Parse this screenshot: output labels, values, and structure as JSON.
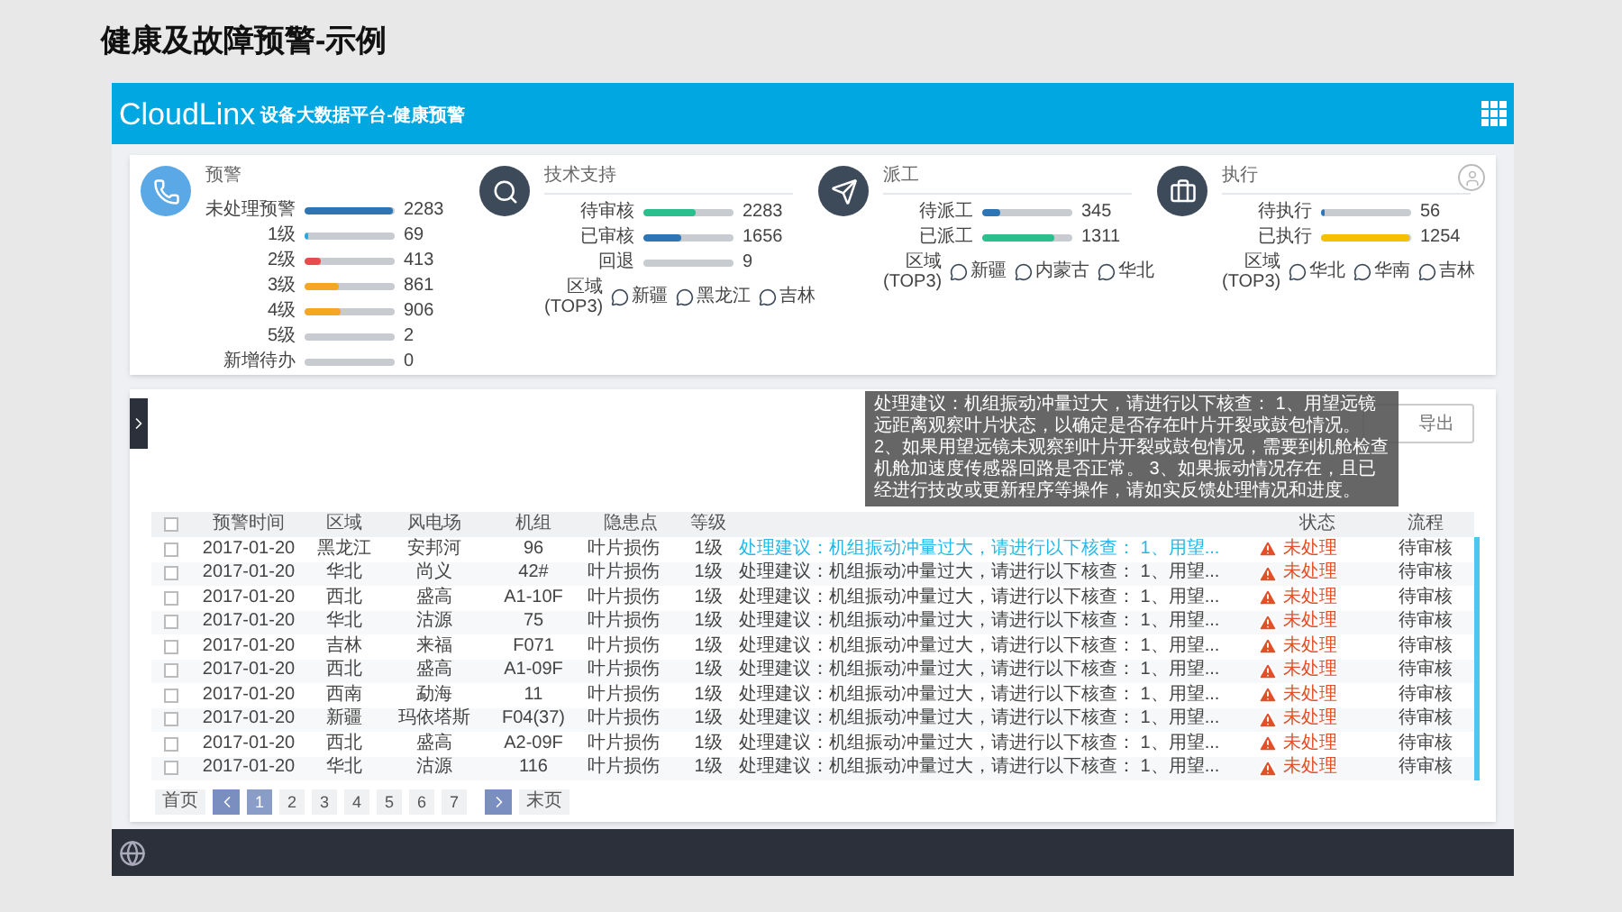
{
  "slide_title": "健康及故障预警-示例",
  "app": {
    "logo": "CloudLinx",
    "title": "设备大数据平台-健康预警"
  },
  "panels": [
    {
      "title": "预警",
      "metrics": [
        {
          "label": "未处理预警",
          "value": "2283",
          "level": 0.97,
          "color": "#2e75b6"
        },
        {
          "label": "1级",
          "value": "69",
          "level": 0.03,
          "color": "#29a8e0"
        },
        {
          "label": "2级",
          "value": "413",
          "level": 0.18,
          "color": "#e84c4c"
        },
        {
          "label": "3级",
          "value": "861",
          "level": 0.38,
          "color": "#f5a623"
        },
        {
          "label": "4级",
          "value": "906",
          "level": 0.4,
          "color": "#f5a623"
        },
        {
          "label": "5级",
          "value": "2"
        },
        {
          "label": "新增待办",
          "value": "0"
        }
      ]
    },
    {
      "title": "技术支持",
      "metrics": [
        {
          "label": "待审核",
          "value": "2283",
          "level": 0.58,
          "color": "#2bbf8e"
        },
        {
          "label": "已审核",
          "value": "1656",
          "level": 0.42,
          "color": "#2e75b6"
        },
        {
          "label": "回退",
          "value": "9"
        }
      ],
      "regions_label": [
        "区域",
        "(TOP3)"
      ],
      "regions": [
        "新疆",
        "黑龙江",
        "吉林"
      ]
    },
    {
      "title": "派工",
      "metrics": [
        {
          "label": "待派工",
          "value": "345",
          "level": 0.2,
          "color": "#2e75b6"
        },
        {
          "label": "已派工",
          "value": "1311",
          "level": 0.8,
          "color": "#2bbf8e"
        }
      ],
      "regions_label": [
        "区域",
        "(TOP3)"
      ],
      "regions": [
        "新疆",
        "内蒙古",
        "华北"
      ]
    },
    {
      "title": "执行",
      "metrics": [
        {
          "label": "待执行",
          "value": "56",
          "level": 0.03,
          "color": "#2e75b6"
        },
        {
          "label": "已执行",
          "value": "1254",
          "level": 0.97,
          "color": "#f5c000"
        }
      ],
      "regions_label": [
        "区域",
        "(TOP3)"
      ],
      "regions": [
        "华北",
        "华南",
        "吉林"
      ]
    }
  ],
  "toolbar": {
    "export_button": "导出"
  },
  "tooltip": "处理建议：机组振动冲量过大，请进行以下核查： 1、用望远镜远距离观察叶片状态，以确定是否存在叶片开裂或鼓包情况。 2、如果用望远镜未观察到叶片开裂或鼓包情况，需要到机舱检查机舱加速度传感器回路是否正常。 3、如果振动情况存在，且已经进行技改或更新程序等操作，请如实反馈处理情况和进度。",
  "table": {
    "select_all_checked": false,
    "columns_left": [
      "预警时间",
      "区域",
      "风电场",
      "机组",
      "隐患点",
      "等级"
    ],
    "columns_right": [
      "状态",
      "流程"
    ],
    "rows": [
      {
        "checked": false,
        "hovered": true,
        "cells": [
          "2017-01-20",
          "黑龙江",
          "安邦河",
          "96",
          "叶片损伤",
          "1级"
        ],
        "suggestion": "处理建议：机组振动冲量过大，请进行以下核查： 1、用望...",
        "status": "未处理",
        "flow": "待审核"
      },
      {
        "checked": false,
        "hovered": false,
        "cells": [
          "2017-01-20",
          "华北",
          "尚义",
          "42#",
          "叶片损伤",
          "1级"
        ],
        "suggestion": "处理建议：机组振动冲量过大，请进行以下核查： 1、用望...",
        "status": "未处理",
        "flow": "待审核"
      },
      {
        "checked": false,
        "hovered": false,
        "cells": [
          "2017-01-20",
          "西北",
          "盛高",
          "A1-10F",
          "叶片损伤",
          "1级"
        ],
        "suggestion": "处理建议：机组振动冲量过大，请进行以下核查： 1、用望...",
        "status": "未处理",
        "flow": "待审核"
      },
      {
        "checked": false,
        "hovered": false,
        "cells": [
          "2017-01-20",
          "华北",
          "沽源",
          "75",
          "叶片损伤",
          "1级"
        ],
        "suggestion": "处理建议：机组振动冲量过大，请进行以下核查： 1、用望...",
        "status": "未处理",
        "flow": "待审核"
      },
      {
        "checked": false,
        "hovered": false,
        "cells": [
          "2017-01-20",
          "吉林",
          "来福",
          "F071",
          "叶片损伤",
          "1级"
        ],
        "suggestion": "处理建议：机组振动冲量过大，请进行以下核查： 1、用望...",
        "status": "未处理",
        "flow": "待审核"
      },
      {
        "checked": false,
        "hovered": false,
        "cells": [
          "2017-01-20",
          "西北",
          "盛高",
          "A1-09F",
          "叶片损伤",
          "1级"
        ],
        "suggestion": "处理建议：机组振动冲量过大，请进行以下核查： 1、用望...",
        "status": "未处理",
        "flow": "待审核"
      },
      {
        "checked": false,
        "hovered": false,
        "cells": [
          "2017-01-20",
          "西南",
          "勐海",
          "11",
          "叶片损伤",
          "1级"
        ],
        "suggestion": "处理建议：机组振动冲量过大，请进行以下核查： 1、用望...",
        "status": "未处理",
        "flow": "待审核"
      },
      {
        "checked": false,
        "hovered": false,
        "cells": [
          "2017-01-20",
          "新疆",
          "玛依塔斯",
          "F04(37)",
          "叶片损伤",
          "1级"
        ],
        "suggestion": "处理建议：机组振动冲量过大，请进行以下核查： 1、用望...",
        "status": "未处理",
        "flow": "待审核"
      },
      {
        "checked": false,
        "hovered": false,
        "cells": [
          "2017-01-20",
          "西北",
          "盛高",
          "A2-09F",
          "叶片损伤",
          "1级"
        ],
        "suggestion": "处理建议：机组振动冲量过大，请进行以下核查： 1、用望...",
        "status": "未处理",
        "flow": "待审核"
      },
      {
        "checked": false,
        "hovered": false,
        "cells": [
          "2017-01-20",
          "华北",
          "沽源",
          "116",
          "叶片损伤",
          "1级"
        ],
        "suggestion": "处理建议：机组振动冲量过大，请进行以下核查： 1、用望...",
        "status": "未处理",
        "flow": "待审核"
      }
    ]
  },
  "pagination": {
    "first": "首页",
    "last": "末页",
    "pages": [
      {
        "label": "1",
        "selected": true
      },
      {
        "label": "2",
        "selected": false
      },
      {
        "label": "3",
        "selected": false
      },
      {
        "label": "4",
        "selected": false
      },
      {
        "label": "5",
        "selected": false
      },
      {
        "label": "6",
        "selected": false
      },
      {
        "label": "7",
        "selected": false
      }
    ]
  }
}
